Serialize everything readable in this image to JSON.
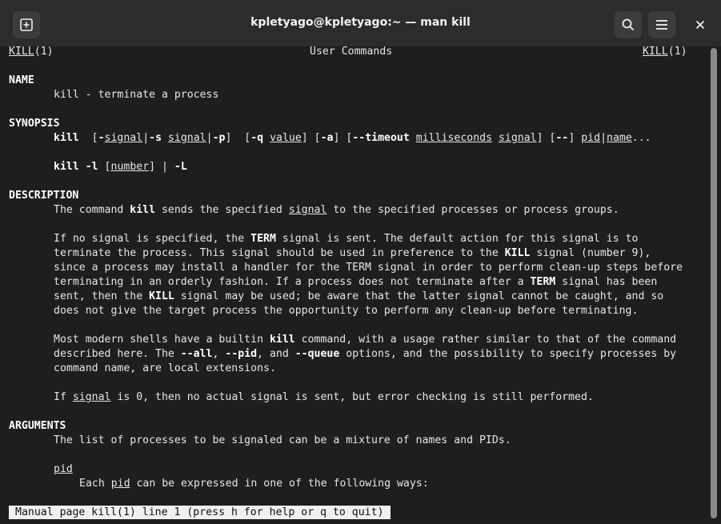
{
  "window": {
    "title": "kpletyago@kpletyago:~ — man kill",
    "new_tab_icon": "new-tab-icon",
    "search_icon": "search-icon",
    "menu_icon": "hamburger-menu-icon",
    "close_icon": "close-icon"
  },
  "man": {
    "header_left": "KILL",
    "header_left_suffix": "(1)",
    "header_center": "User Commands",
    "header_right": "KILL",
    "header_right_suffix": "(1)",
    "sections": {
      "name": "NAME",
      "synopsis": "SYNOPSIS",
      "description": "DESCRIPTION",
      "arguments": "ARGUMENTS"
    },
    "name_line": "kill - terminate a process",
    "desc_p1": {
      "a": "The command ",
      "b": "kill",
      "c": " sends the specified ",
      "d": "signal",
      "e": " to the specified processes or process groups."
    },
    "desc_p2": [
      "If no signal is specified, the ",
      "TERM",
      " signal is sent. The default action for this signal is to",
      "terminate the process. This signal should be used in preference to the ",
      "KILL",
      " signal (number 9),",
      "since a process may install a handler for the TERM signal in order to perform clean-up steps before",
      "terminating in an orderly fashion. If a process does not terminate after a ",
      "TERM",
      " signal has been",
      "sent, then the ",
      "KILL",
      " signal may be used; be aware that the latter signal cannot be caught, and so",
      "does not give the target process the opportunity to perform any clean-up before terminating."
    ],
    "desc_p3": [
      "Most modern shells have a builtin ",
      "kill",
      " command, with a usage rather similar to that of the command",
      "described here. The ",
      "--all",
      ", ",
      "--pid",
      ", and ",
      "--queue",
      " options, and the possibility to specify processes by",
      "command name, are local extensions."
    ],
    "desc_p4": {
      "a": "If ",
      "b": "signal",
      "c": " is 0, then no actual signal is sent, but error checking is still performed."
    },
    "args_p1": "The list of processes to be signaled can be a mixture of names and PIDs.",
    "args_pid": "pid",
    "args_pid_desc": {
      "a": "Each ",
      "b": "pid",
      "c": " can be expressed in one of the following ways:"
    },
    "status": "Manual page kill(1) line 1 (press h for help or q to quit)"
  }
}
